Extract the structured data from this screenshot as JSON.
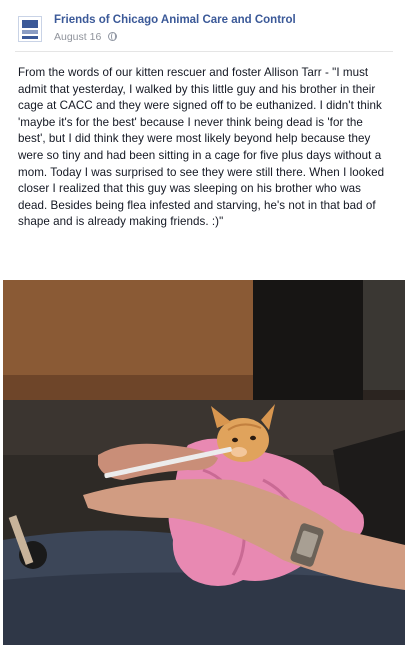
{
  "post": {
    "page_name": "Friends of Chicago Animal Care and Control",
    "date": "August 16",
    "privacy_icon": "globe-icon",
    "body": "From the words of our kitten rescuer and foster Allison Tarr - \"I must admit that yesterday, I walked by this little guy and his brother in their cage at CACC and they were signed off to be euthanized. I didn't think 'maybe it's for the best' because I never think being dead is 'for the best', but I did think they were most likely beyond help because they were so tiny and had been sitting in a cage for five plus days without a mom. Today I was surprised to see they were still there. When I looked closer I realized that this guy was sleeping on his brother who was dead. Besides being flea infested and starving, he's not in that bad of shape and is already making friends. :)\""
  },
  "colors": {
    "link": "#3b5998",
    "meta": "#90949c",
    "text": "#141823",
    "towel": "#e889b2",
    "kitten": "#e0a35c"
  }
}
